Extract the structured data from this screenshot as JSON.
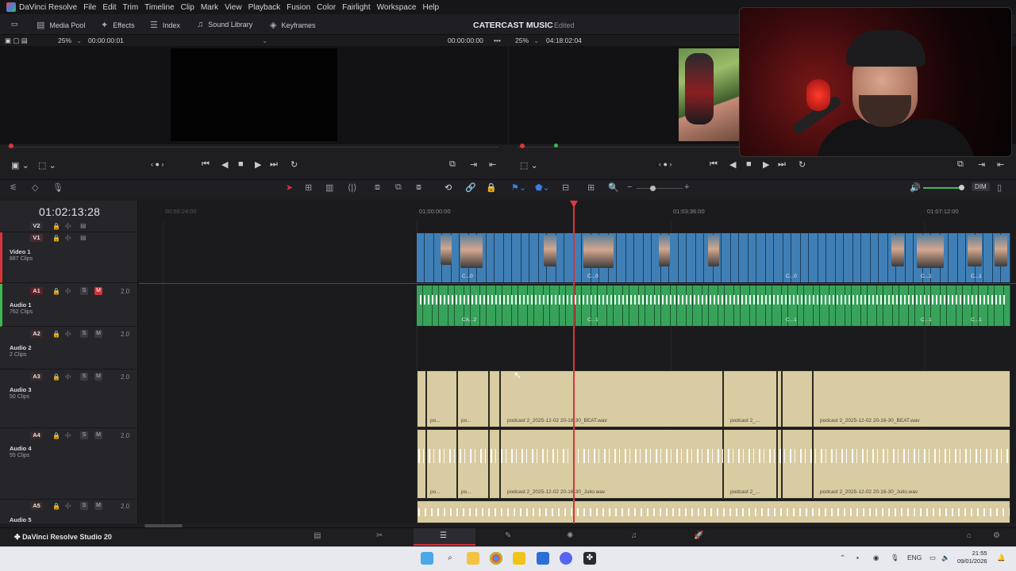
{
  "app": {
    "name": "DaVinci Resolve",
    "project_title": "CATERCAST MUSIC",
    "project_status": "Edited",
    "brand_label": "DaVinci Resolve Studio 20"
  },
  "menu": [
    "DaVinci Resolve",
    "File",
    "Edit",
    "Trim",
    "Timeline",
    "Clip",
    "Mark",
    "View",
    "Playback",
    "Fusion",
    "Color",
    "Fairlight",
    "Workspace",
    "Help"
  ],
  "toolbar": {
    "media_pool": "Media Pool",
    "effects": "Effects",
    "index": "Index",
    "sound_library": "Sound Library",
    "keyframes": "Keyframes"
  },
  "source_viewer": {
    "zoom": "25%",
    "timecode": "00:00:00:01"
  },
  "program_viewer": {
    "left_timecode": "00:00:00:00",
    "zoom": "25%",
    "duration": "04:18:02:04"
  },
  "timeline": {
    "current_timecode": "01:02:13:28",
    "ruler": [
      "00:56:24:00",
      "01:00:00:00",
      "01:03:36:00",
      "01:07:12:00"
    ],
    "dim_label": "DIM"
  },
  "tracks": [
    {
      "id": "V2",
      "type": "video"
    },
    {
      "id": "V1",
      "type": "video",
      "name": "Video 1",
      "clips": "887 Clips"
    },
    {
      "id": "A1",
      "type": "audio",
      "name": "Audio 1",
      "clips": "762 Clips",
      "channels": "2.0",
      "muted": true
    },
    {
      "id": "A2",
      "type": "audio",
      "name": "Audio 2",
      "clips": "2 Clips",
      "channels": "2.0"
    },
    {
      "id": "A3",
      "type": "audio",
      "name": "Audio 3",
      "clips": "50 Clips",
      "channels": "2.0"
    },
    {
      "id": "A4",
      "type": "audio",
      "name": "Audio 4",
      "clips": "55 Clips",
      "channels": "2.0"
    },
    {
      "id": "A5",
      "type": "audio",
      "name": "Audio 5",
      "channels": "2.0"
    }
  ],
  "clip_labels": {
    "v_co": "C...0",
    "v_cl": "C...1",
    "a_ca2": "CA...2",
    "a_cl": "C...1",
    "a3_short": "po...",
    "a3_beat": "podcast 2_2025-12-02 20-16-30_BEAT.wav",
    "a3_mid": "podcast 2_...",
    "a4_julio": "podcast 2_2025-12-02 20-16-30_Julio.wav",
    "a4_mid": "podcast 2_...",
    "track_solo": "S",
    "track_mute": "M"
  },
  "taskbar": {
    "language": "ENG",
    "time": "21:55",
    "date": "09/01/2026"
  }
}
